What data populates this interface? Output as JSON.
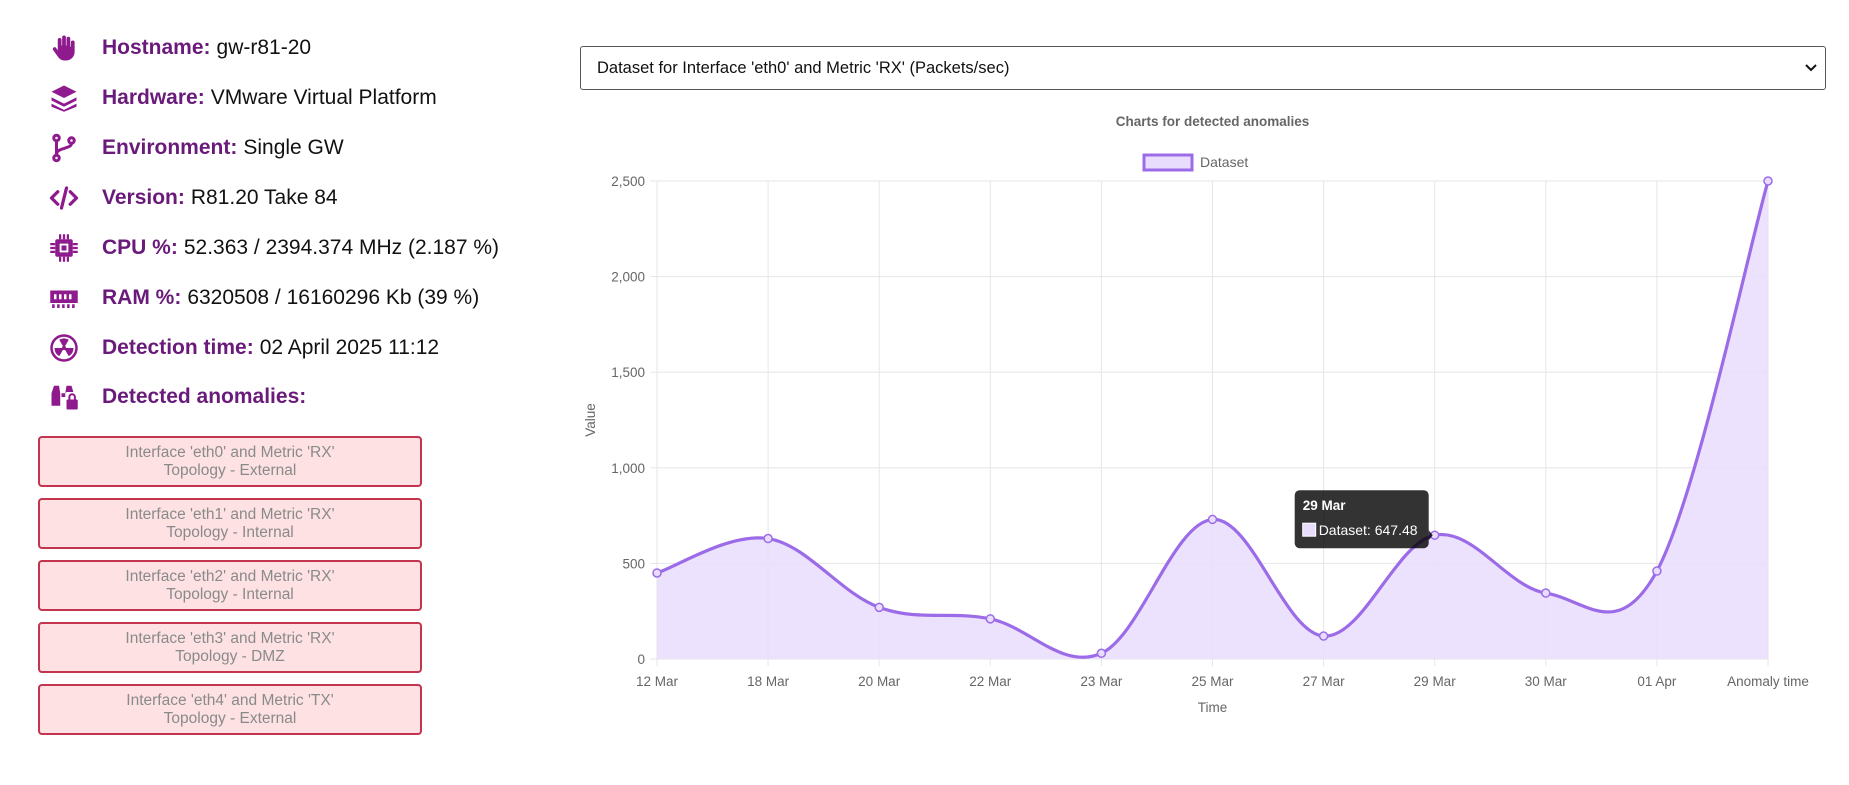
{
  "info": [
    {
      "icon": "hand-icon",
      "label": "Hostname:",
      "value": "gw-r81-20"
    },
    {
      "icon": "layers-icon",
      "label": "Hardware:",
      "value": "VMware Virtual Platform"
    },
    {
      "icon": "branch-icon",
      "label": "Environment:",
      "value": "Single GW"
    },
    {
      "icon": "code-icon",
      "label": "Version:",
      "value": "R81.20 Take 84"
    },
    {
      "icon": "cpu-icon",
      "label": "CPU %:",
      "value": "52.363 / 2394.374 MHz (2.187 %)"
    },
    {
      "icon": "memory-icon",
      "label": "RAM %:",
      "value": "6320508 / 16160296 Kb (39 %)"
    },
    {
      "icon": "radiation-icon",
      "label": "Detection time:",
      "value": "02 April 2025 11:12"
    },
    {
      "icon": "binoculars-lock-icon",
      "label": "Detected anomalies:",
      "value": ""
    }
  ],
  "anomalies": [
    {
      "line1": "Interface 'eth0' and Metric 'RX'",
      "line2": "Topology - External"
    },
    {
      "line1": "Interface 'eth1' and Metric 'RX'",
      "line2": "Topology - Internal"
    },
    {
      "line1": "Interface 'eth2' and Metric 'RX'",
      "line2": "Topology - Internal"
    },
    {
      "line1": "Interface 'eth3' and Metric 'RX'",
      "line2": "Topology - DMZ"
    },
    {
      "line1": "Interface 'eth4' and Metric 'TX'",
      "line2": "Topology - External"
    }
  ],
  "dataset_select": {
    "value": "Dataset for Interface 'eth0' and Metric 'RX' (Packets/sec)"
  },
  "colors": {
    "accent": "#6a1a7a",
    "line": "#9c6ce8",
    "fill": "#e9ddfd",
    "alert_border": "#c3344e",
    "alert_bg": "#fde1e3"
  },
  "chart_data": {
    "type": "area",
    "title": "Charts for detected anomalies",
    "xlabel": "Time",
    "ylabel": "Value",
    "categories": [
      "12 Mar",
      "18 Mar",
      "20 Mar",
      "22 Mar",
      "23 Mar",
      "25 Mar",
      "27 Mar",
      "29 Mar",
      "30 Mar",
      "01 Apr",
      "Anomaly time"
    ],
    "series": [
      {
        "name": "Dataset",
        "values": [
          450,
          630,
          270,
          210,
          30,
          730,
          120,
          647.48,
          345,
          460,
          2500
        ]
      }
    ],
    "ylim": [
      0,
      2500
    ],
    "yticks": [
      0,
      500,
      1000,
      1500,
      2000,
      2500
    ],
    "ytick_labels": [
      "0",
      "500",
      "1,000",
      "1,500",
      "2,000",
      "2,500"
    ],
    "grid": true,
    "legend": "top-center",
    "tooltip": {
      "title": "29 Mar",
      "label": "Dataset: 647.48"
    }
  }
}
